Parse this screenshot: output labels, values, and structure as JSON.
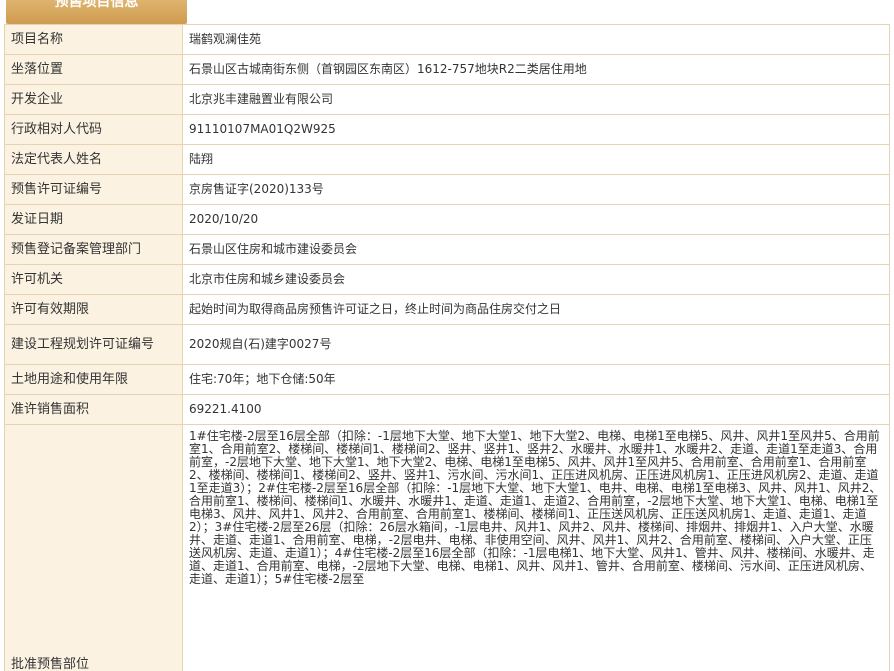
{
  "section": {
    "title": "预售项目信息"
  },
  "rows": [
    {
      "label": "项目名称",
      "value": "瑞鹤观澜佳苑"
    },
    {
      "label": "坐落位置",
      "value": "石景山区古城南街东侧（首钢园区东南区）1612-757地块R2二类居住用地"
    },
    {
      "label": "开发企业",
      "value": "北京兆丰建融置业有限公司"
    },
    {
      "label": "行政相对人代码",
      "value": "91110107MA01Q2W925"
    },
    {
      "label": "法定代表人姓名",
      "value": "陆翔"
    },
    {
      "label": "预售许可证编号",
      "value": "京房售证字(2020)133号"
    },
    {
      "label": "发证日期",
      "value": "2020/10/20"
    },
    {
      "label": "预售登记备案管理部门",
      "value": "石景山区住房和城市建设委员会"
    },
    {
      "label": "许可机关",
      "value": "北京市住房和城乡建设委员会"
    },
    {
      "label": "许可有效期限",
      "value": "起始时间为取得商品房预售许可证之日，终止时间为商品住房交付之日"
    },
    {
      "label": "建设工程规划许可证编号",
      "value": "2020规自(石)建字0027号"
    },
    {
      "label": "土地用途和使用年限",
      "value": "住宅:70年；地下仓储:50年"
    },
    {
      "label": "准许销售面积",
      "value": "69221.4100"
    },
    {
      "label": "批准预售部位",
      "value": "1#住宅楼-2层至16层全部（扣除：-1层地下大堂、地下大堂1、地下大堂2、电梯、电梯1至电梯5、风井、风井1至风井5、合用前室1、合用前室2、楼梯间、楼梯间1、楼梯间2、竖井、竖井1、竖井2、水暖井、水暖井1、水暖井2、走道、走道1至走道3、合用前室，-2层地下大堂、地下大堂1、地下大堂2、电梯、电梯1至电梯5、风井、风井1至风井5、合用前室、合用前室1、合用前室2、楼梯间、楼梯间1、楼梯间2、竖井、竖井1、污水间、污水间1、正压进风机房、正压进风机房1、正压进风机房2、走道、走道1至走道3）；2#住宅楼-2层至16层全部（扣除：-1层地下大堂、地下大堂1、电井、电梯、电梯1至电梯3、风井、风井1、风井2、合用前室1、楼梯间、楼梯间1、水暖井、水暖井1、走道、走道1、走道2、合用前室，-2层地下大堂、地下大堂1、电梯、电梯1至电梯3、风井、风井1、风井2、合用前室、合用前室1、楼梯间、楼梯间1、正压送风机房、正压送风机房1、走道、走道1、走道2）；3#住宅楼-2层至26层（扣除：26层水箱间，-1层电井、风井1、风井2、风井、楼梯间、排烟井、排烟井1、入户大堂、水暖井、走道、走道1、合用前室、电梯，-2层电井、电梯、非使用空间、风井、风井1、风井2、合用前室、楼梯间、入户大堂、正压送风机房、走道、走道1）；4#住宅楼-2层至16层全部（扣除：-1层电梯1、地下大堂、风井1、管井、风井、楼梯间、水暖井、走道、走道1、合用前室、电梯，-2层地下大堂、电梯、电梯1、风井、风井1、管井、合用前室、楼梯间、污水间、正压进风机房、走道、走道1）；5#住宅楼-2层至"
    }
  ]
}
